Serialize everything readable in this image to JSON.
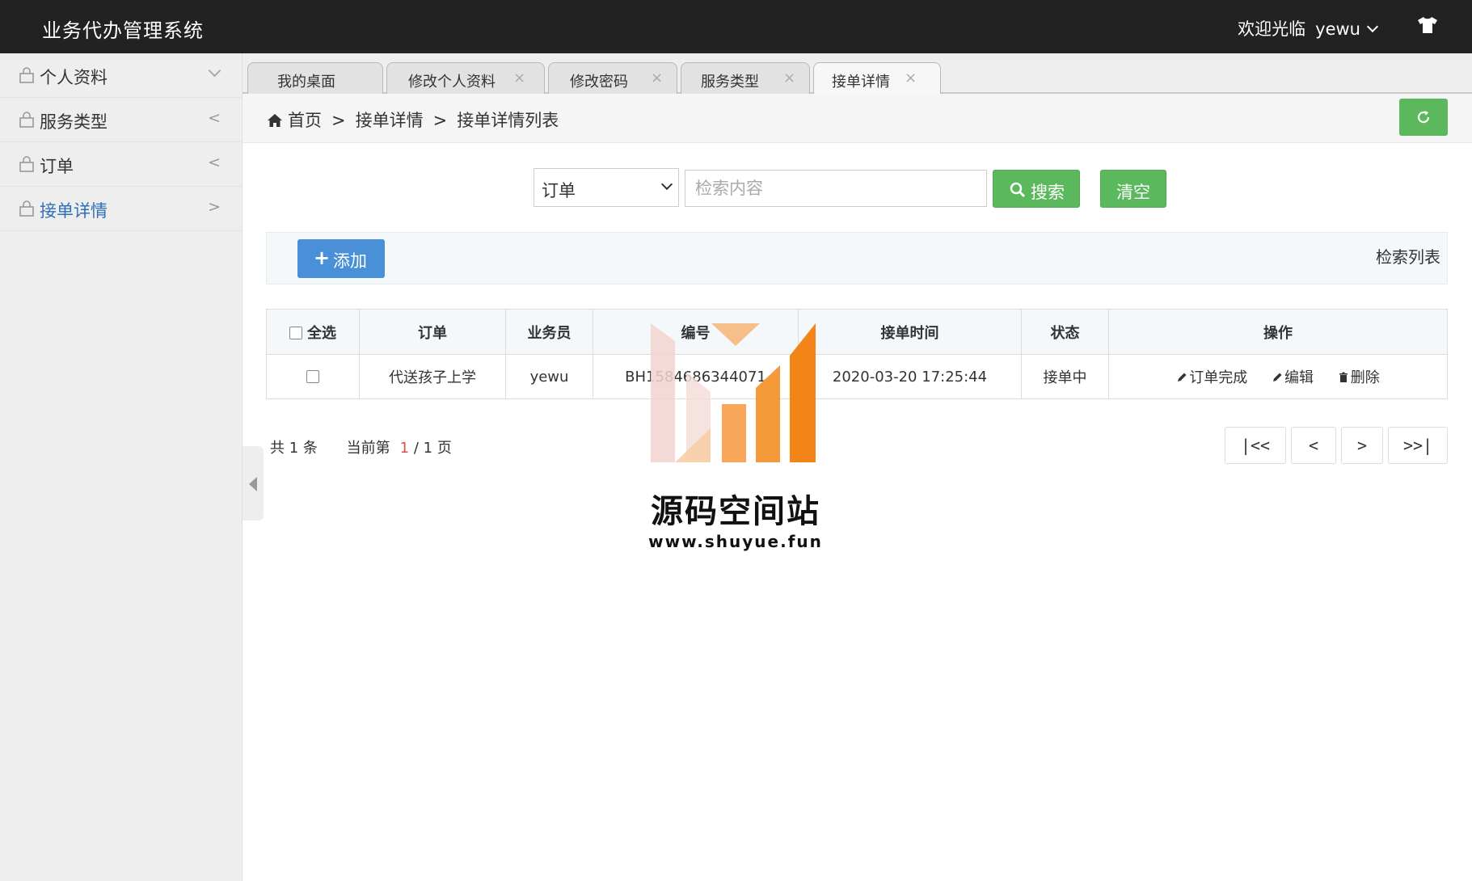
{
  "app": {
    "title": "业务代办管理系统"
  },
  "header": {
    "welcome": "欢迎光临",
    "username": "yewu"
  },
  "sidebar": {
    "items": [
      {
        "label": "个人资料",
        "arrow": "down"
      },
      {
        "label": "服务类型",
        "arrow": "<"
      },
      {
        "label": "订单",
        "arrow": "<"
      },
      {
        "label": "接单详情",
        "arrow": ">",
        "active": true
      }
    ]
  },
  "tabs": [
    {
      "label": "我的桌面"
    },
    {
      "label": "修改个人资料",
      "close": "×"
    },
    {
      "label": "修改密码",
      "close": "×"
    },
    {
      "label": "服务类型",
      "close": "×"
    },
    {
      "label": "接单详情",
      "close": "×",
      "active": true
    }
  ],
  "breadcrumb": {
    "home": "首页",
    "sep": ">",
    "level1": "接单详情",
    "level2": "接单详情列表"
  },
  "search": {
    "field_value": "订单",
    "placeholder": "检索内容",
    "search_label": "搜索",
    "clear_label": "清空"
  },
  "toolbar": {
    "add_label": "添加",
    "list_title": "检索列表"
  },
  "table": {
    "headers": {
      "select_all": "全选",
      "order": "订单",
      "staff": "业务员",
      "number": "编号",
      "time": "接单时间",
      "status": "状态",
      "actions": "操作"
    },
    "rows": [
      {
        "order": "代送孩子上学",
        "staff": "yewu",
        "number": "BH1584686344071",
        "time": "2020-03-20 17:25:44",
        "status": "接单中"
      }
    ],
    "actions": {
      "complete": "订单完成",
      "edit": "编辑",
      "delete": "删除"
    }
  },
  "pager": {
    "total_prefix": "共",
    "total": "1",
    "total_suffix": "条",
    "page_prefix": "当前第",
    "current": "1",
    "page_sep": "/",
    "pages": "1",
    "page_suffix": "页",
    "first": "|<<",
    "prev": "<",
    "next": ">",
    "last": ">>|"
  },
  "watermark": {
    "name": "源码空间站",
    "url": "www.shuyue.fun"
  },
  "colors": {
    "topbar": "#222222",
    "primary_green": "#5cb85c",
    "primary_blue": "#4a90d9",
    "active_link": "#2f6fb6",
    "page_red": "#d9534f"
  }
}
